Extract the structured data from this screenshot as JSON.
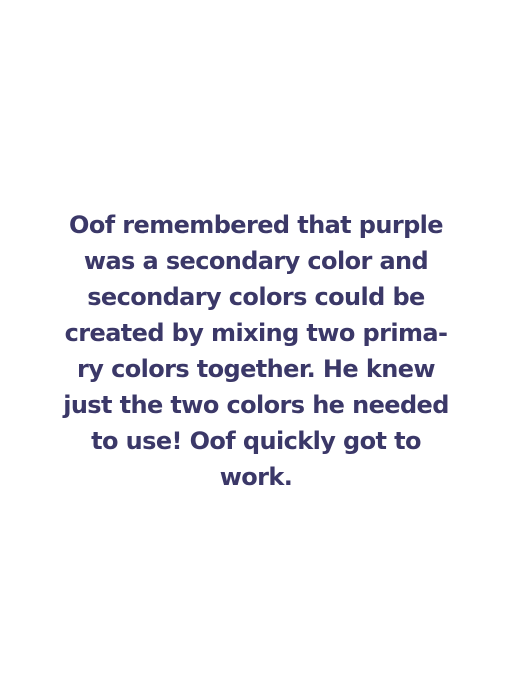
{
  "story": {
    "lines": [
      "Oof remembered that purple",
      "was a secondary color and",
      "secondary colors could be",
      "created by mixing two prima-",
      "ry colors together. He knew",
      "just the two colors he needed",
      "to use! Oof quickly got to",
      "work."
    ]
  },
  "colors": {
    "text": "#3b3868",
    "background": "#ffffff"
  }
}
